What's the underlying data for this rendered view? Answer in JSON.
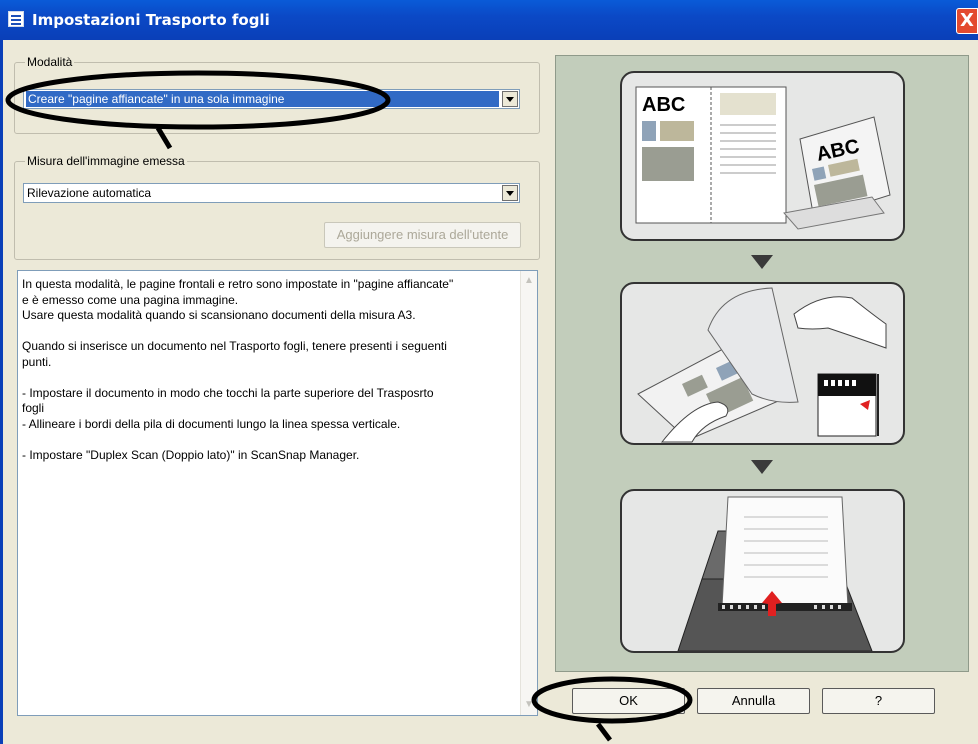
{
  "window": {
    "title": "Impostazioni Trasporto fogli",
    "close_glyph": "X"
  },
  "modalita": {
    "label": "Modalità",
    "value": "Creare \"pagine affiancate\" in una sola immagine"
  },
  "misura": {
    "label": "Misura dell'immagine emessa",
    "value": "Rilevazione automatica",
    "add_button": "Aggiungere misura dell'utente"
  },
  "description": {
    "lines": [
      "In questa modalità, le pagine frontali e retro sono impostate in \"pagine affiancate\"",
      "e è emesso come una pagina immagine.",
      "Usare questa modalità quando si scansionano documenti della misura A3.",
      "",
      "Quando si inserisce un documento nel Trasporto fogli, tenere presenti i seguenti",
      "punti.",
      "",
      "- Impostare il documento in modo che tocchi la parte superiore del Trasposrto",
      "fogli",
      "- Allineare i bordi della pila di documenti lungo la linea spessa verticale.",
      "",
      "- Impostare \"Duplex Scan (Doppio lato)\" in ScanSnap Manager."
    ]
  },
  "illustration": {
    "abc_text": "ABC",
    "abc_text_2": "ABC"
  },
  "buttons": {
    "ok": "OK",
    "cancel": "Annulla",
    "help": "?"
  },
  "colors": {
    "titlebar": "#0a4ac6",
    "selection": "#316ac5",
    "annotation": "#000000",
    "marker": "#e02020"
  }
}
